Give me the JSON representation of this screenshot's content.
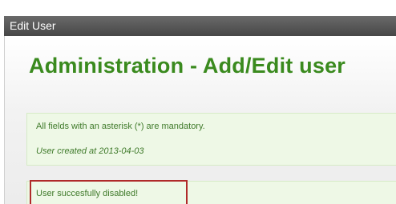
{
  "window": {
    "title": "Edit User"
  },
  "page": {
    "heading": "Administration - Add/Edit user"
  },
  "notice": {
    "mandatory_text": "All fields with an asterisk (*) are mandatory.",
    "created_text": "User created at 2013-04-03"
  },
  "success": {
    "message": "User succesfully disabled!"
  },
  "colors": {
    "title_bar": "#555555",
    "heading_green": "#3a8a1e",
    "message_bg": "#eef8e6",
    "message_text": "#3f7a2a",
    "highlight_border": "#b02a2a"
  }
}
